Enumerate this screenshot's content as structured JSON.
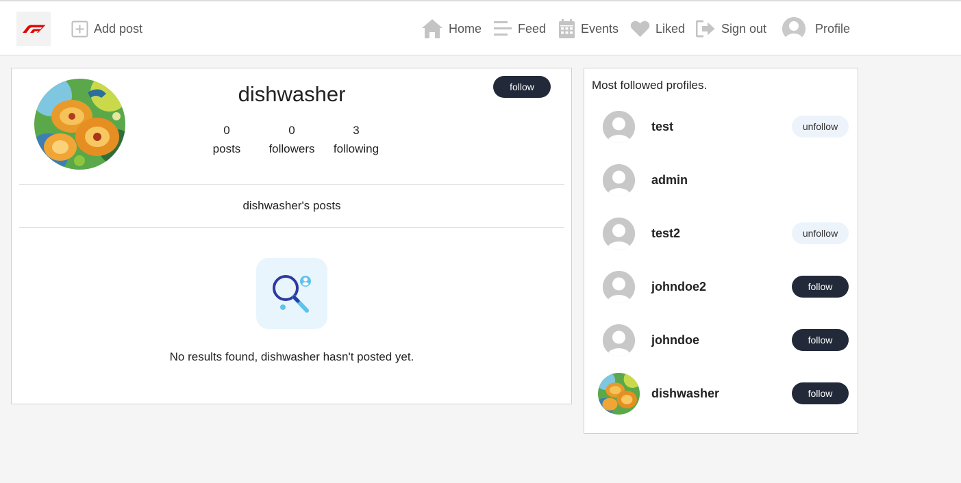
{
  "nav": {
    "add_post": "Add post",
    "home": "Home",
    "feed": "Feed",
    "events": "Events",
    "liked": "Liked",
    "sign_out": "Sign out",
    "profile": "Profile",
    "icons": [
      "f1-logo-icon",
      "plus-square-icon",
      "home-icon",
      "menu-lines-icon",
      "calendar-icon",
      "heart-icon",
      "sign-out-icon",
      "user-avatar-icon"
    ]
  },
  "profile": {
    "username": "dishwasher",
    "follow_label": "follow",
    "stats": {
      "posts_count": "0",
      "posts_label": "posts",
      "followers_count": "0",
      "followers_label": "followers",
      "following_count": "3",
      "following_label": "following"
    },
    "posts_heading": "dishwasher's posts",
    "empty_message": "No results found, dishwasher hasn't posted yet."
  },
  "sidebar": {
    "title": "Most followed profiles.",
    "profiles": [
      {
        "name": "test",
        "button": "unfollow",
        "avatar": "default"
      },
      {
        "name": "admin",
        "button": "",
        "avatar": "default"
      },
      {
        "name": "test2",
        "button": "unfollow",
        "avatar": "default"
      },
      {
        "name": "johndoe2",
        "button": "follow",
        "avatar": "default"
      },
      {
        "name": "johndoe",
        "button": "follow",
        "avatar": "default"
      },
      {
        "name": "dishwasher",
        "button": "follow",
        "avatar": "flowers"
      }
    ]
  },
  "colors": {
    "accent_dark": "#222939",
    "unfollow_bg": "#edf3fb",
    "logo_red": "#e10600",
    "nav_icon": "#c4c4c4"
  }
}
